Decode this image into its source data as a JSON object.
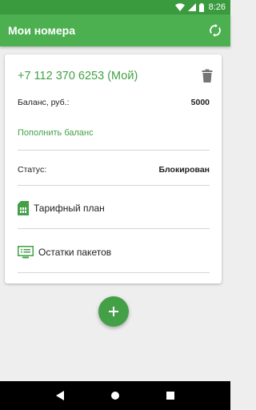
{
  "status_bar": {
    "time": "8:26"
  },
  "app_bar": {
    "title": "Мои номера",
    "action_icon": "refresh-icon"
  },
  "card": {
    "phone": "+7 112 370 6253 (Мой)",
    "balance_label": "Баланс, руб.:",
    "balance_value": "5000",
    "topup_link": "Пополнить баланс",
    "status_label": "Статус:",
    "status_value": "Блокирован",
    "menu": [
      {
        "label": "Тарифный план",
        "icon": "sim-card-icon"
      },
      {
        "label": "Остатки пакетов",
        "icon": "packages-list-icon"
      }
    ]
  },
  "fab": {
    "icon": "plus-icon"
  },
  "colors": {
    "primary": "#4caf50",
    "primary_dark": "#3a9a3e",
    "accent": "#43a047",
    "background": "#eeeeee"
  }
}
